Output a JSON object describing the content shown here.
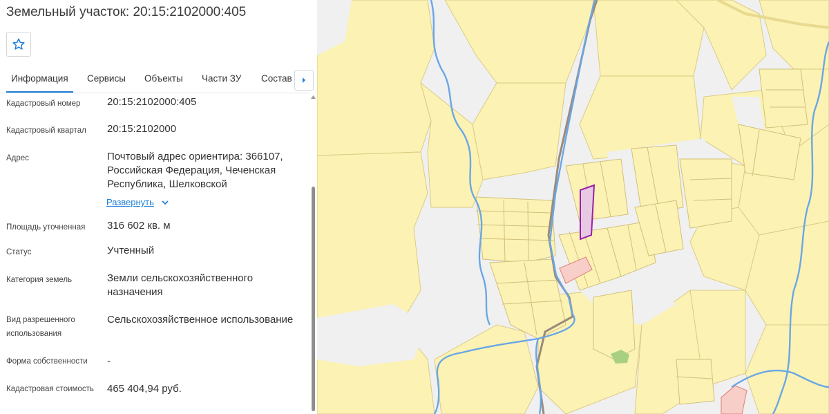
{
  "panel": {
    "title": "Земельный участок: 20:15:2102000:405",
    "favorite_icon": "star-outline-icon",
    "tabs": [
      {
        "label": "Информация",
        "active": true
      },
      {
        "label": "Сервисы",
        "active": false
      },
      {
        "label": "Объекты",
        "active": false
      },
      {
        "label": "Части ЗУ",
        "active": false
      },
      {
        "label": "Состав",
        "active": false
      }
    ],
    "tabs_next_icon": "caret-right-icon",
    "accent_color": "#1e7fd6",
    "fields": [
      {
        "label": "Кадастровый номер",
        "value": "20:15:2102000:405"
      },
      {
        "label": "Кадастровый квартал",
        "value": "20:15:2102000"
      },
      {
        "label": "Адрес",
        "value": "Почтовый адрес ориентира: 366107, Российская Федерация, Чеченская Республика, Шелковской"
      },
      {
        "label": "Площадь уточненная",
        "value": "316 602 кв. м"
      },
      {
        "label": "Статус",
        "value": "Учтенный"
      },
      {
        "label": "Категория земель",
        "value": "Земли сельскохозяйственного назначения"
      },
      {
        "label": "Вид разрешенного использования",
        "value": "Сельскохозяйственное использование"
      },
      {
        "label": "Форма собственности",
        "value": "-"
      },
      {
        "label": "Кадастровая стоимость",
        "value": "465 404,94 руб."
      }
    ],
    "expand_label": "Развернуть",
    "expand_icon": "chevron-down-icon"
  },
  "map": {
    "parcel_fill": "#fbf2b4",
    "parcel_border": "#d9c87a",
    "background": "#f0f0f0",
    "river_color": "#6aa6e6",
    "selected_parcel_border": "#9b1fa8",
    "highlight_parcel_fill": "#f7cfc8"
  }
}
